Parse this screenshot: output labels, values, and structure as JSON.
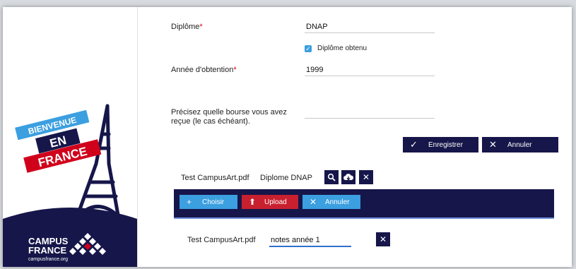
{
  "logo": {
    "bienvenue": "BIENVENUE",
    "en": "EN",
    "france": "FRANCE",
    "campus": "CAMPUS",
    "france2": "FRANCE",
    "url": "campusfrance.org"
  },
  "form": {
    "diplome_label": "Diplôme",
    "diplome_value": "DNAP",
    "obtenu_label": "Diplôme obtenu",
    "annee_label": "Année d'obtention",
    "annee_value": "1999",
    "bourse_label_1": "Précisez quelle bourse vous avez",
    "bourse_label_2": "reçue (le cas échéant).",
    "bourse_value": "",
    "required_mark": "*"
  },
  "actions": {
    "save_label": "Enregistrer",
    "cancel_label": "Annuler"
  },
  "attachment": {
    "file_name": "Test CampusArt.pdf",
    "doc_type": "Diplome DNAP"
  },
  "upload_bar": {
    "choose_label": "Choisir",
    "upload_label": "Upload",
    "cancel_label": "Annuler"
  },
  "pending": {
    "file_name": "Test CampusArt.pdf",
    "description_value": "notes année 1"
  },
  "icons": {
    "check": "check-icon",
    "close": "close-icon",
    "search": "search-icon",
    "cloud": "cloud-download-icon",
    "plus": "plus-icon",
    "upload": "upload-icon"
  },
  "colors": {
    "navy": "#16164a",
    "red": "#d0021b",
    "blue": "#3b9fe0",
    "upload_red": "#c8202f"
  }
}
